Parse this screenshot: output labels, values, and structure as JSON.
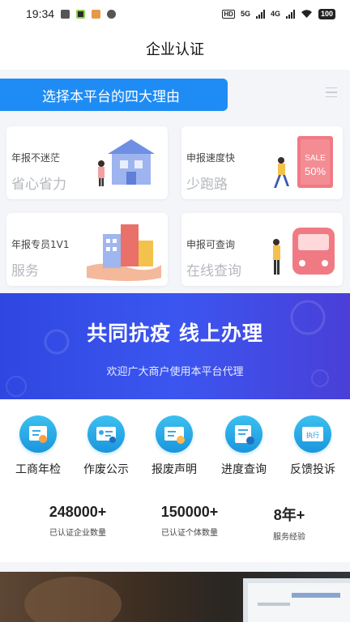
{
  "status_bar": {
    "time": "19:34",
    "network_5g": "5G",
    "network_4g": "4G",
    "battery": "100",
    "hd_label": "HD"
  },
  "nav": {
    "title": "企业认证"
  },
  "reasons": {
    "banner": "选择本平台的四大理由",
    "cards": [
      {
        "sub": "年报不迷茫",
        "main": "省心省力",
        "art": "house-illustration"
      },
      {
        "sub": "申报速度快",
        "main": "少跑路",
        "art": "sale-tag-illustration",
        "art_text_1": "SALE",
        "art_text_2": "50%"
      },
      {
        "sub": "年报专员1V1",
        "main": "服务",
        "art": "hand-building-illustration"
      },
      {
        "sub": "申报可查询",
        "main": "在线查询",
        "art": "train-illustration"
      }
    ]
  },
  "hero": {
    "title": "共同抗疫 线上办理",
    "subtitle": "欢迎广大商户使用本平台代理"
  },
  "services": [
    {
      "label": "工商年检",
      "icon": "certificate-icon"
    },
    {
      "label": "作废公示",
      "icon": "id-card-icon"
    },
    {
      "label": "报废声明",
      "icon": "edit-document-icon"
    },
    {
      "label": "进度查询",
      "icon": "progress-document-icon"
    },
    {
      "label": "反馈投诉",
      "icon": "feedback-icon",
      "icon_text": "执行"
    }
  ],
  "stats": [
    {
      "number": "248000+",
      "label": "已认证企业数量"
    },
    {
      "number": "150000+",
      "label": "已认证个体数量"
    },
    {
      "number": "8年+",
      "label": "服务经验"
    }
  ],
  "colors": {
    "primary": "#1f8cf5",
    "hero_bg": "#3b56f0",
    "sale_red": "#f0607a"
  }
}
